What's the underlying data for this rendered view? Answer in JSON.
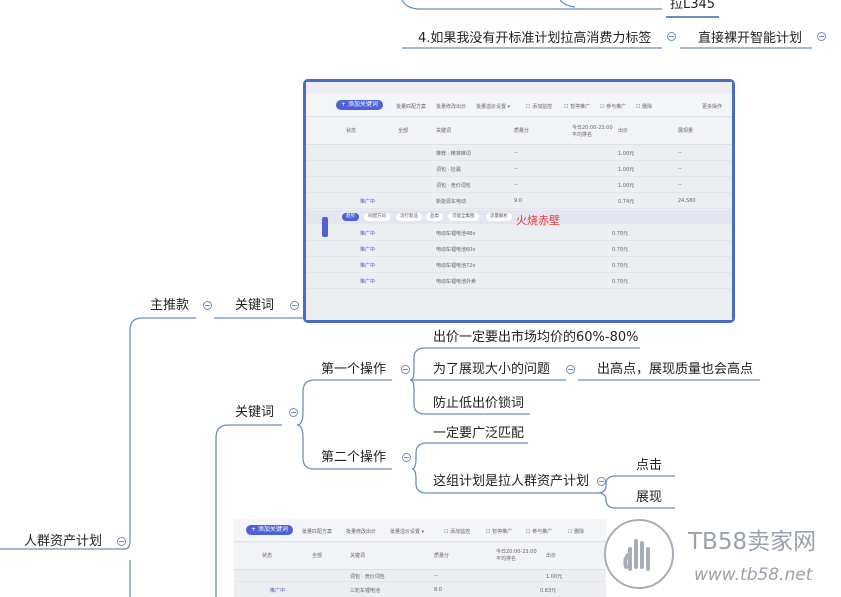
{
  "mindmap": {
    "top_leaf": "拉L345",
    "rule4": "4.如果我没有开标准计划拉高消费力标签",
    "rule4_child": "直接裸开智能计划",
    "root": "人群资产计划",
    "main_push": "主推款",
    "keyword_a": "关键词",
    "keyword_b": "关键词",
    "op1": "第一个操作",
    "op1_items": [
      "出价一定要出市场均价的60%-80%",
      "为了展现大小的问题",
      "防止低出价锁词"
    ],
    "op1_sub": "出高点，展现质量也会高点",
    "op2": "第二个操作",
    "op2_items": [
      "一定要广泛匹配",
      "这组计划是拉人群资产计划"
    ],
    "op2_sub": [
      "点击",
      "展现"
    ]
  },
  "screenshot1": {
    "add_button": "+ 添加关键词",
    "headers": [
      "状态",
      "全部",
      "关键词",
      "质量分",
      "今日20:00-23:00 平均排名",
      "出价",
      "展现量"
    ],
    "rows": [
      {
        "status": "",
        "keyword": "推荐 · 精准推词",
        "price": "1.00元"
      },
      {
        "status": "",
        "keyword": "词包 · 捡漏",
        "price": "1.00元"
      },
      {
        "status": "",
        "keyword": "词包 · 竞价词包",
        "price": "1.00元"
      },
      {
        "status": "推广中",
        "keyword": "新能源车电动",
        "price": "0.74元"
      }
    ],
    "tags": [
      "趋势",
      "同配方词",
      "流行新品",
      "品类",
      "可能全集图",
      "流量解析"
    ],
    "red_annotation": "火烧赤壁",
    "rows2": [
      {
        "status": "推广中",
        "keyword": "电动车锂电池48v",
        "price": "0.70元"
      },
      {
        "status": "推广中",
        "keyword": "电动车锂电池60v",
        "price": "0.70元"
      },
      {
        "status": "推广中",
        "keyword": "电动车锂电池72v",
        "price": "0.70元"
      },
      {
        "status": "推广中",
        "keyword": "电动车锂电池外卖",
        "price": "0.70元"
      }
    ]
  },
  "screenshot2": {
    "add_button": "+ 添加关键词",
    "headers": [
      "状态",
      "全部",
      "关键词",
      "质量分",
      "今日20:00-23:00 平均排名",
      "出价"
    ],
    "rows": [
      {
        "status": "",
        "keyword": "词包 · 竞价词包",
        "price": "1.00元"
      },
      {
        "status": "推广中",
        "keyword": "三轮车锂电池",
        "price": "0.83元"
      }
    ]
  },
  "watermark": {
    "brand": "TB58卖家网",
    "url": "www.tb58.net"
  },
  "colors": {
    "connector": "#6c8ebf",
    "frame": "#4a6cc4",
    "accent_red": "#e43b3b"
  }
}
